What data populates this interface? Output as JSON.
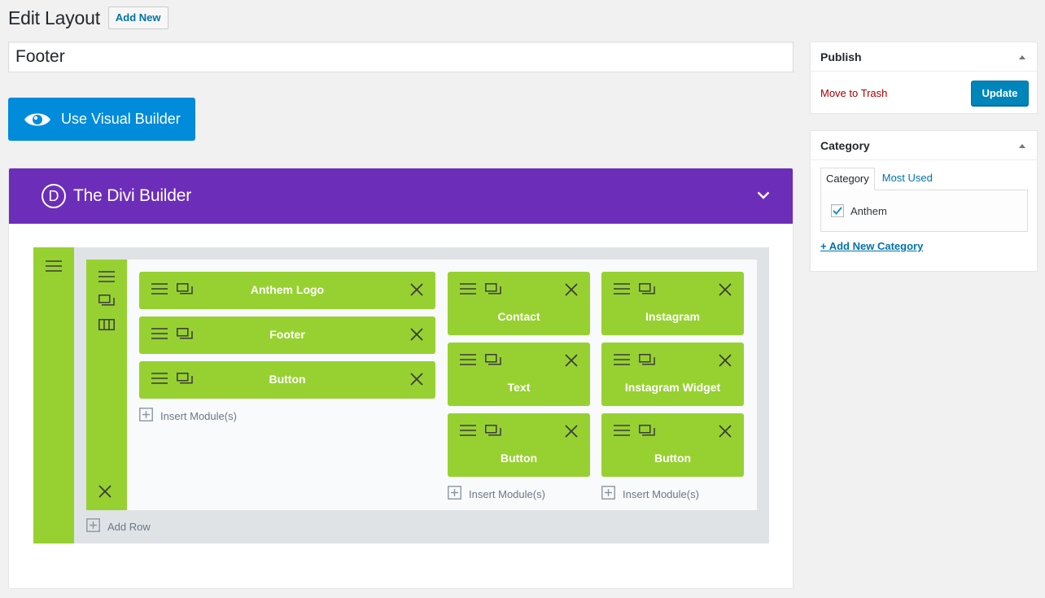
{
  "header": {
    "title": "Edit Layout",
    "add_new_label": "Add New"
  },
  "title_field": {
    "value": "Footer"
  },
  "visual_builder": {
    "label": "Use Visual Builder"
  },
  "divi": {
    "logo_letter": "D",
    "title": "The Divi Builder",
    "add_row_label": "Add Row",
    "columns": [
      {
        "modules": [
          "Anthem Logo",
          "Footer",
          "Button"
        ],
        "insert_label": "Insert Module(s)"
      },
      {
        "modules": [
          "Contact",
          "Text",
          "Button"
        ],
        "insert_label": "Insert Module(s)"
      },
      {
        "modules": [
          "Instagram",
          "Instagram Widget",
          "Button"
        ],
        "insert_label": "Insert Module(s)"
      }
    ]
  },
  "publish": {
    "title": "Publish",
    "trash_label": "Move to Trash",
    "update_label": "Update"
  },
  "category": {
    "title": "Category",
    "tabs": [
      "Category",
      "Most Used"
    ],
    "items": [
      {
        "label": "Anthem",
        "checked": true
      }
    ],
    "add_label": "+ Add New Category"
  },
  "colors": {
    "accent": "#0073aa",
    "divi_purple": "#6c2eb9",
    "module_green": "#97d131",
    "vb_blue": "#008bdb"
  }
}
